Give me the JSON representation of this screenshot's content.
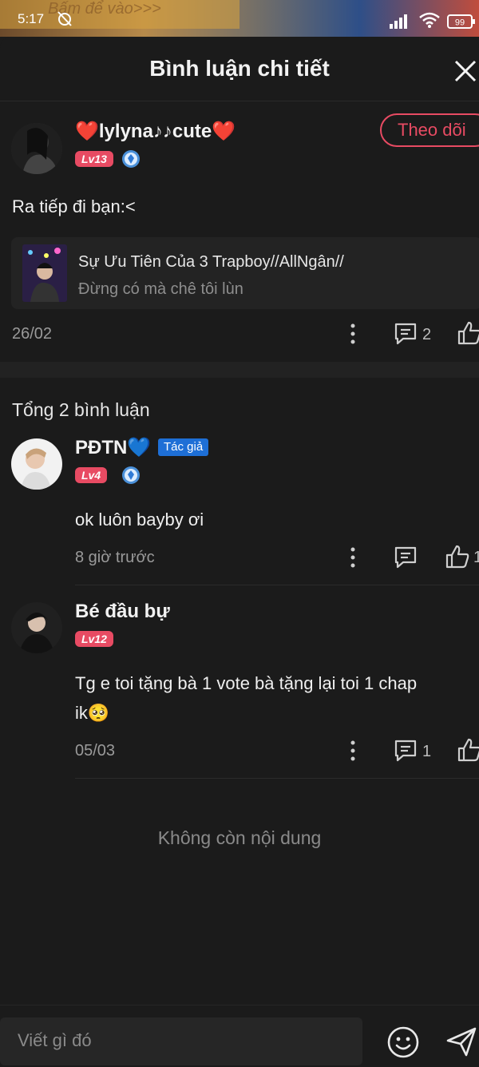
{
  "status": {
    "time": "5:17",
    "banner_text": "Bấm để vào>>>",
    "battery": "99"
  },
  "header": {
    "title": "Bình luận chi tiết"
  },
  "main_comment": {
    "username": "❤️lylyna♪♪cute❤️",
    "level": "Lv13",
    "follow_label": "Theo dõi",
    "text": "Ra tiếp đi bạn:<",
    "story": {
      "title": "Sự Ưu Tiên Của 3 Trapboy//AllNgân//",
      "subtitle": "Đừng có mà chê tôi lùn"
    },
    "date": "26/02",
    "reply_count": "2"
  },
  "total_label": "Tổng 2 bình luận",
  "comments": [
    {
      "username": "PĐTN💙",
      "author_tag": "Tác giả",
      "level": "Lv4",
      "text": "ok luôn bayby ơi",
      "time": "8 giờ trước",
      "like_count": "1"
    },
    {
      "username": "Bé đầu bự",
      "level": "Lv12",
      "text_line1": "Tg e toi tặng bà 1 vote bà tặng lại toi 1 chap",
      "text_line2": "ik🥺",
      "time": "05/03",
      "reply_count": "1"
    }
  ],
  "end_text": "Không còn nội dung",
  "input": {
    "placeholder": "Viết gì đó"
  },
  "colors": {
    "accent": "#e84b63",
    "author_tag": "#1e6fd6",
    "background": "#1b1b1b"
  }
}
